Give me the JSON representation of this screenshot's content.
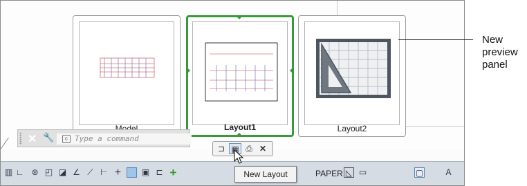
{
  "cards": [
    {
      "label": "Model"
    },
    {
      "label": "Layout1"
    },
    {
      "label": "Layout2"
    }
  ],
  "command_line": {
    "placeholder": "Type a command"
  },
  "mini_toolbar": {
    "tooltip": "New Layout"
  },
  "status_bar": {
    "paper_label": "PAPER"
  },
  "annotation": {
    "line1": "New",
    "line2": "preview",
    "line3": "panel"
  },
  "colors": {
    "active_border": "#3a9a3a",
    "status_bg": "#d6dce4",
    "plus_icon": "#2aa12a",
    "drawing_lines": "#cc3333"
  }
}
